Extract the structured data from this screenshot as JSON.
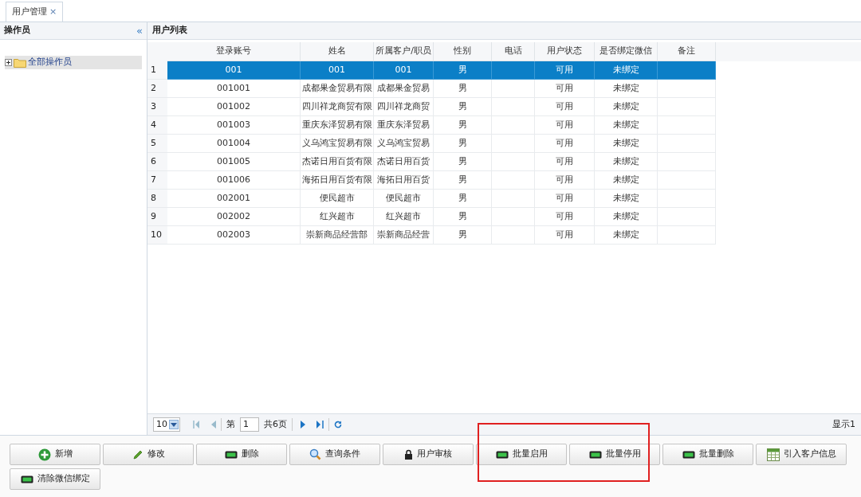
{
  "tabs": [
    {
      "label": "用户管理",
      "close": "×",
      "selected": true
    }
  ],
  "left_panel": {
    "title": "操作员",
    "collapse": "«",
    "tree": [
      {
        "label": "全部操作员",
        "expanded": false,
        "selected": true
      }
    ]
  },
  "table": {
    "title": "用户列表",
    "columns": [
      "登录账号",
      "姓名",
      "所属客户/职员",
      "性别",
      "电话",
      "用户状态",
      "是否绑定微信",
      "备注"
    ],
    "rows": [
      {
        "num": "1",
        "cells": [
          "001",
          "001",
          "001",
          "男",
          "",
          "可用",
          "未绑定",
          ""
        ],
        "selected": true
      },
      {
        "num": "2",
        "cells": [
          "001001",
          "成都果金贸易有限",
          "成都果金贸易",
          "男",
          "",
          "可用",
          "未绑定",
          ""
        ],
        "selected": false
      },
      {
        "num": "3",
        "cells": [
          "001002",
          "四川祥龙商贸有限",
          "四川祥龙商贸",
          "男",
          "",
          "可用",
          "未绑定",
          ""
        ],
        "selected": false
      },
      {
        "num": "4",
        "cells": [
          "001003",
          "重庆东泽贸易有限",
          "重庆东泽贸易",
          "男",
          "",
          "可用",
          "未绑定",
          ""
        ],
        "selected": false
      },
      {
        "num": "5",
        "cells": [
          "001004",
          "义乌鸿宝贸易有限",
          "义乌鸿宝贸易",
          "男",
          "",
          "可用",
          "未绑定",
          ""
        ],
        "selected": false
      },
      {
        "num": "6",
        "cells": [
          "001005",
          "杰诺日用百货有限",
          "杰诺日用百货",
          "男",
          "",
          "可用",
          "未绑定",
          ""
        ],
        "selected": false
      },
      {
        "num": "7",
        "cells": [
          "001006",
          "海拓日用百货有限",
          "海拓日用百货",
          "男",
          "",
          "可用",
          "未绑定",
          ""
        ],
        "selected": false
      },
      {
        "num": "8",
        "cells": [
          "002001",
          "便民超市",
          "便民超市",
          "男",
          "",
          "可用",
          "未绑定",
          ""
        ],
        "selected": false
      },
      {
        "num": "9",
        "cells": [
          "002002",
          "红兴超市",
          "红兴超市",
          "男",
          "",
          "可用",
          "未绑定",
          ""
        ],
        "selected": false
      },
      {
        "num": "10",
        "cells": [
          "002003",
          "崇新商品经营部",
          "崇新商品经营",
          "男",
          "",
          "可用",
          "未绑定",
          ""
        ],
        "selected": false
      }
    ]
  },
  "pager": {
    "page_size": "10",
    "page_prefix": "第",
    "page": "1",
    "page_total": "共6页",
    "display": "显示1"
  },
  "buttons": [
    {
      "label": "新增",
      "kind": "plus"
    },
    {
      "label": "修改",
      "kind": "pencil"
    },
    {
      "label": "删除",
      "kind": "bar"
    },
    {
      "label": "查询条件",
      "kind": "search"
    },
    {
      "label": "用户审核",
      "kind": "lock"
    },
    {
      "label": "批量启用",
      "kind": "bar"
    },
    {
      "label": "批量停用",
      "kind": "bar"
    },
    {
      "label": "批量删除",
      "kind": "bar"
    },
    {
      "label": "引入客户信息",
      "kind": "sheet"
    },
    {
      "label": "清除微信绑定",
      "kind": "bar"
    }
  ]
}
